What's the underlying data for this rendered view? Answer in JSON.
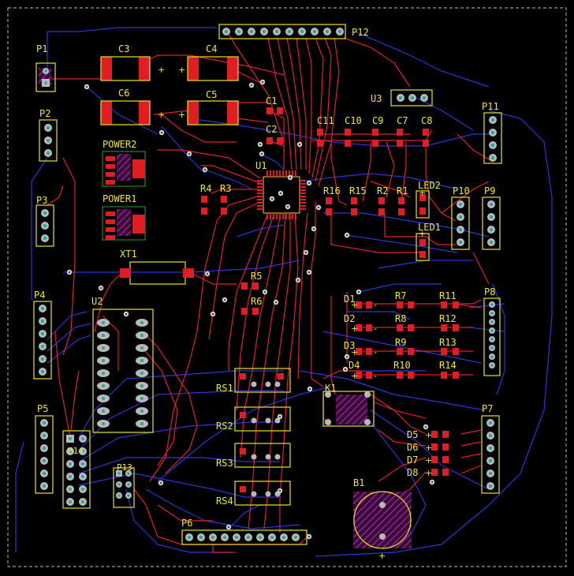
{
  "board": {
    "background": "#000000",
    "silk_color": "#f2e81a",
    "top_copper_color": "#e0202a",
    "bottom_copper_color": "#2a36d9"
  },
  "labels": {
    "P1": "P1",
    "P2": "P2",
    "P3": "P3",
    "P4": "P4",
    "P5": "P5",
    "P6": "P6",
    "P7": "P7",
    "P8": "P8",
    "P9": "P9",
    "P10": "P10",
    "P11": "P11",
    "P12": "P12",
    "P13": "P13",
    "P14": "P14",
    "C1": "C1",
    "C2": "C2",
    "C3": "C3",
    "C4": "C4",
    "C5": "C5",
    "C6": "C6",
    "C7": "C7",
    "C8": "C8",
    "C9": "C9",
    "C10": "C10",
    "C11": "C11",
    "U1": "U1",
    "U2": "U2",
    "U3": "U3",
    "R1": "R1",
    "R2": "R2",
    "R3": "R3",
    "R4": "R4",
    "R5": "R5",
    "R6": "R6",
    "R7": "R7",
    "R8": "R8",
    "R9": "R9",
    "R10": "R10",
    "R11": "R11",
    "R12": "R12",
    "R13": "R13",
    "R14": "R14",
    "R15": "R15",
    "R16": "R16",
    "D1": "D1",
    "D2": "D2",
    "D3": "D3",
    "D4": "D4",
    "D5": "D5",
    "D6": "D6",
    "D7": "D7",
    "D8": "D8",
    "LED1": "LED1",
    "LED2": "LED2",
    "POWER1": "POWER1",
    "POWER2": "POWER2",
    "XT1": "XT1",
    "K1": "K1",
    "B1": "B1",
    "RS1": "RS1",
    "RS2": "RS2",
    "RS3": "RS3",
    "RS4": "RS4",
    "plus": "+",
    "minus": "-"
  }
}
